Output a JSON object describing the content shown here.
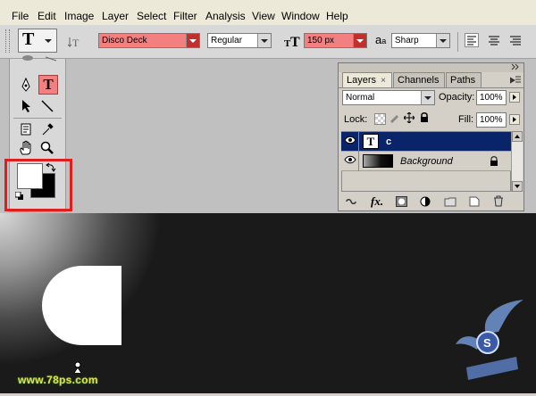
{
  "menu": [
    "File",
    "Edit",
    "Image",
    "Layer",
    "Select",
    "Filter",
    "Analysis",
    "View",
    "Window",
    "Help"
  ],
  "options": {
    "tool_glyph": "T",
    "font_family": "Disco Deck",
    "font_style": "Regular",
    "font_size": "150 px",
    "aa_label": "a",
    "aa_label2": "a",
    "antialias": "Sharp"
  },
  "layers_panel": {
    "tabs": [
      "Layers",
      "Channels",
      "Paths"
    ],
    "tab_close": "×",
    "blend_mode": "Normal",
    "opacity_label": "Opacity:",
    "opacity_value": "100%",
    "lock_label": "Lock:",
    "fill_label": "Fill:",
    "fill_value": "100%",
    "layers": [
      {
        "name": "c",
        "type": "text",
        "thumb": "T",
        "selected": true
      },
      {
        "name": "Background",
        "type": "image",
        "selected": false
      }
    ]
  },
  "toolbox": {
    "type_tool": "T"
  },
  "watermarks": {
    "left": "www.78ps.com"
  },
  "colors": {
    "selection_blue": "#0a246a",
    "highlight_red": "#f28080",
    "annotation_red": "#e11e1e"
  }
}
